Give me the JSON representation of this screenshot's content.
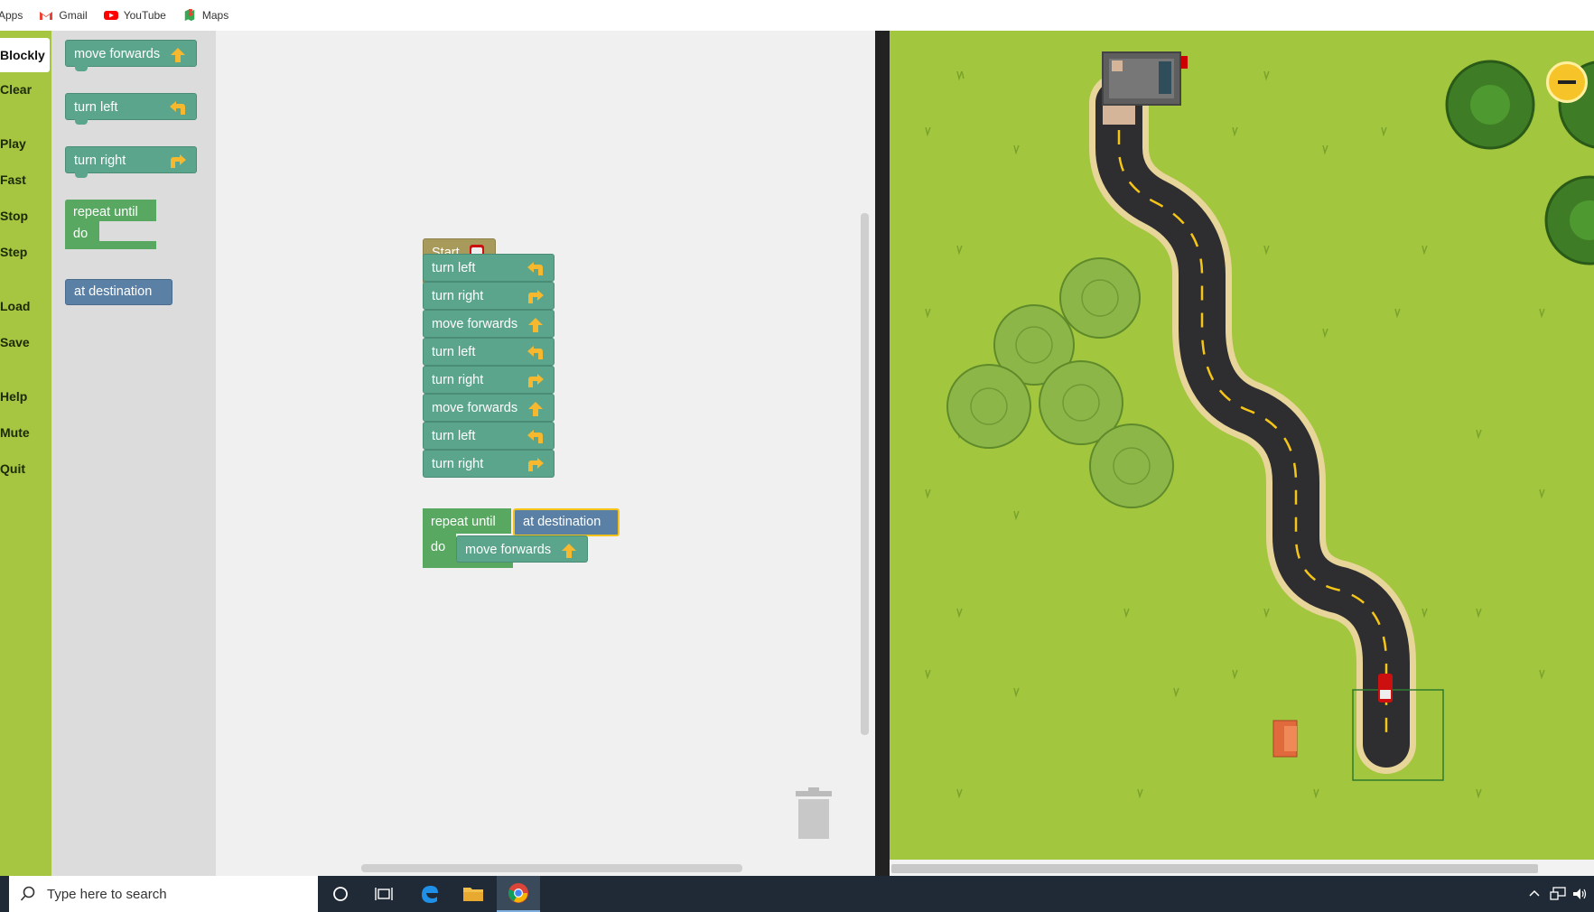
{
  "bookmarks": [
    {
      "label": "Apps",
      "icon": "apps-grid-icon"
    },
    {
      "label": "Gmail",
      "icon": "gmail-icon"
    },
    {
      "label": "YouTube",
      "icon": "youtube-icon"
    },
    {
      "label": "Maps",
      "icon": "maps-icon"
    }
  ],
  "sidebar": {
    "items": [
      {
        "label": "Blockly",
        "active": true
      },
      {
        "label": "Clear"
      },
      {
        "label": "Play"
      },
      {
        "label": "Fast"
      },
      {
        "label": "Stop"
      },
      {
        "label": "Step"
      },
      {
        "label": "Load"
      },
      {
        "label": "Save"
      },
      {
        "label": "Help"
      },
      {
        "label": "Mute"
      },
      {
        "label": "Quit"
      }
    ]
  },
  "toolbox": {
    "move_forwards": "move forwards",
    "turn_left": "turn left",
    "turn_right": "turn right",
    "repeat_until": "repeat until",
    "do": "do",
    "at_destination": "at destination"
  },
  "program": {
    "start": "Start",
    "steps": [
      "turn left",
      "turn right",
      "move forwards",
      "turn left",
      "turn right",
      "move forwards",
      "turn left",
      "turn right"
    ],
    "repeat_until": "repeat until",
    "condition": "at destination",
    "do": "do",
    "loop_body": "move forwards"
  },
  "taskbar": {
    "search_placeholder": "Type here to search"
  },
  "colors": {
    "sidebar": "#a6c541",
    "action_block": "#5ba58c",
    "loop_block": "#59a861",
    "condition_block": "#5b80a5",
    "start_block": "#a89a5a",
    "grass": "#a2c63e",
    "road": "#2e2e30"
  }
}
